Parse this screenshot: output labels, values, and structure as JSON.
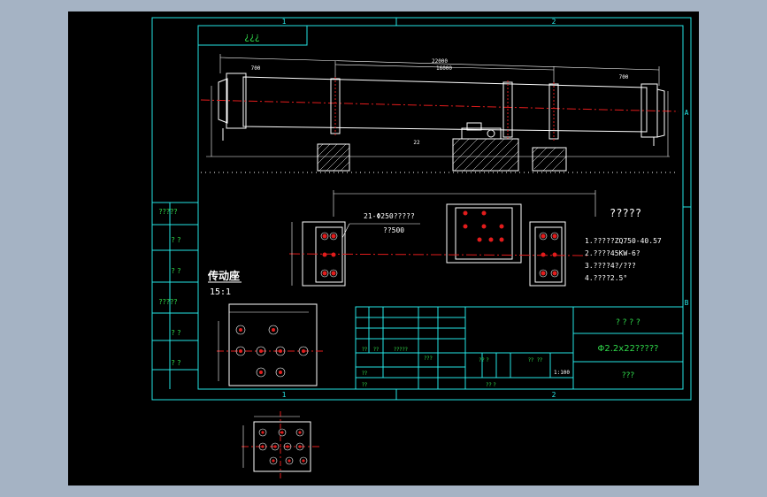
{
  "drawing": {
    "title_block_code": "¿¿¿",
    "zone_labels": {
      "top_1": "1",
      "top_2": "2",
      "bottom_1": "1",
      "bottom_2": "2",
      "right_a": "A",
      "right_b": "B"
    },
    "left_column_labels": [
      "?????",
      "? ?",
      "? ?",
      "?????",
      "? ?",
      "? ?"
    ],
    "main_dims": {
      "overall": "22000",
      "span": "16000",
      "left_end": "700",
      "right_end": "700",
      "mid": "22"
    },
    "base_callout": {
      "line1": "21-Φ250?????",
      "line2": "??500"
    },
    "detail_view": {
      "title": "传动座",
      "scale": "15:1"
    },
    "tech_requirements": {
      "title": "?????",
      "items": [
        "1.?????ZQ750-40.57",
        "2.????45KW-6?",
        "3.????4?/???",
        "4.????2.5°"
      ]
    },
    "title_block": {
      "company": "? ? ? ?",
      "part_name": "Φ2.2x22?????",
      "drawing_no": "???",
      "scale": "1:100",
      "cells": [
        "??",
        "??",
        "?????",
        "???",
        "??",
        "??",
        "?? ?",
        "??",
        "??",
        "?? ?"
      ]
    },
    "colors": {
      "background": "#a5b3c4",
      "paper": "#000000",
      "frame": "#25e5e5",
      "geometry": "#ffffff",
      "centerline": "#e21c1c",
      "annotation": "#2fd84a"
    }
  }
}
